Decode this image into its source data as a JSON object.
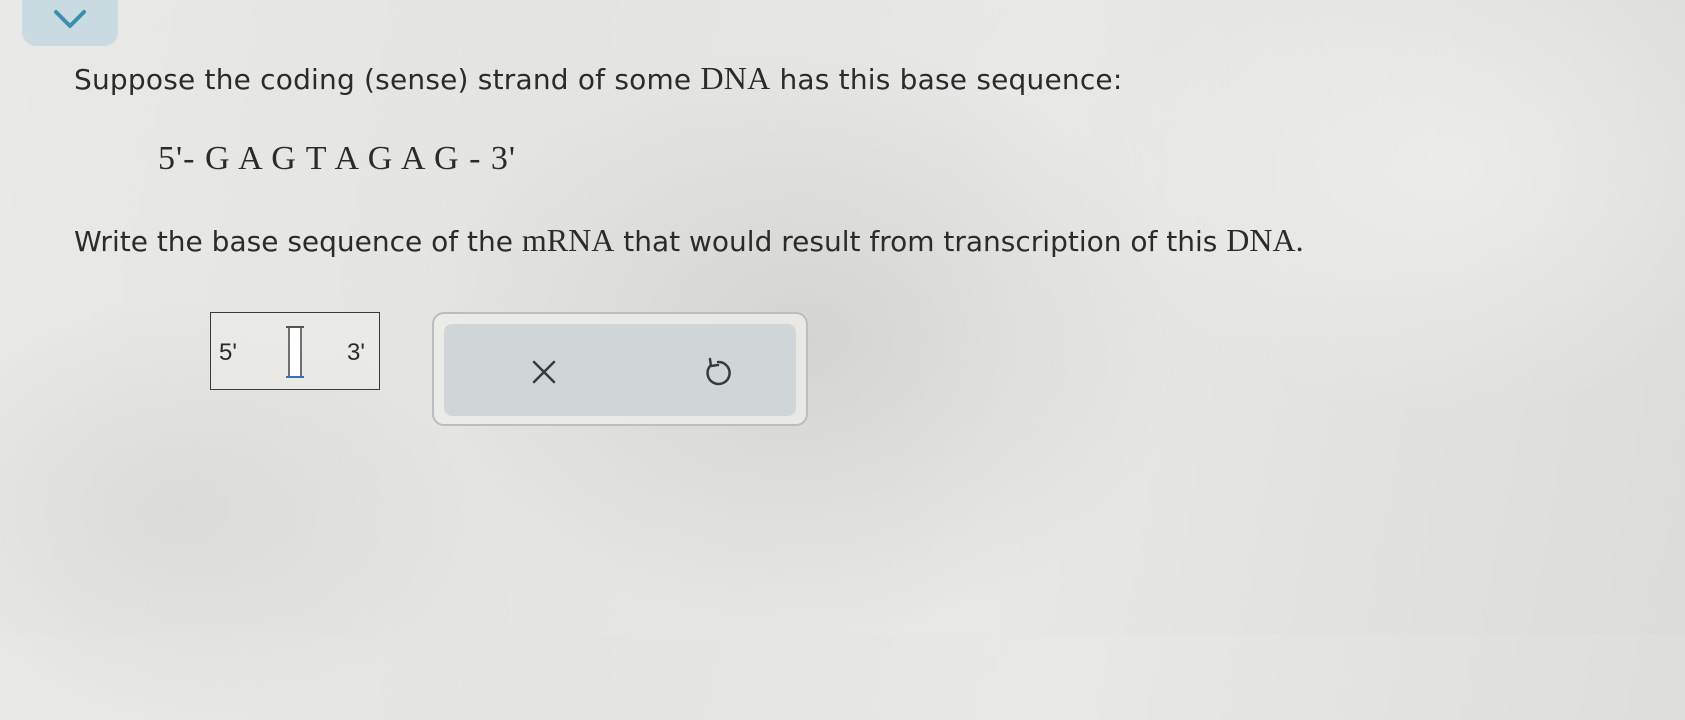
{
  "question": {
    "part1": "Suppose the coding (sense) strand of some ",
    "term1": "DNA",
    "part2": " has this base sequence:"
  },
  "sequence": "5'- G A G T A G A G - 3'",
  "instruction": {
    "part1": "Write the base sequence of the ",
    "term1": "mRNA",
    "part2": " that would result from transcription of this ",
    "term2": "DNA."
  },
  "answer": {
    "five_prime_label": "5'",
    "three_prime_label": "3'",
    "value": ""
  },
  "actions": {
    "clear_icon": "close-icon",
    "undo_icon": "undo-icon"
  },
  "colors": {
    "tab": "#c9dbe0",
    "chevron": "#3b8fb0",
    "panel_inner": "#d0d5d7"
  }
}
